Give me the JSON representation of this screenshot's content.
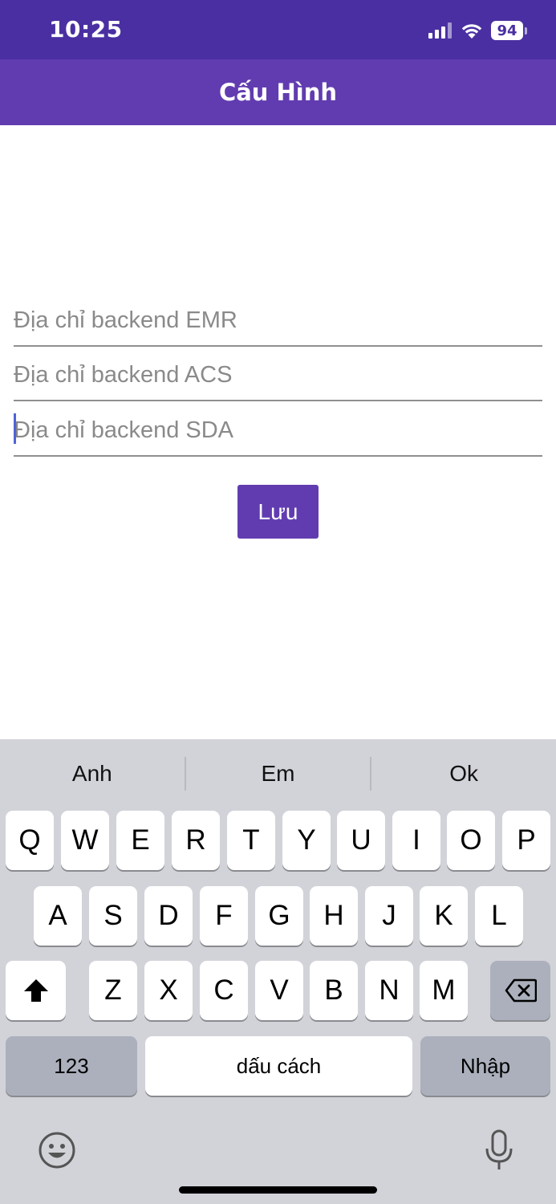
{
  "status_bar": {
    "time": "10:25",
    "battery": "94",
    "icons": [
      "signal-icon",
      "wifi-icon",
      "battery-icon"
    ]
  },
  "app_bar": {
    "title": "Cấu Hình"
  },
  "form": {
    "fields": [
      {
        "placeholder": "Địa chỉ backend EMR",
        "value": ""
      },
      {
        "placeholder": "Địa chỉ backend ACS",
        "value": ""
      },
      {
        "placeholder": "Địa chỉ backend SDA",
        "value": ""
      }
    ],
    "save_label": "Lưu"
  },
  "keyboard": {
    "suggestions": [
      "Anh",
      "Em",
      "Ok"
    ],
    "row1": [
      "Q",
      "W",
      "E",
      "R",
      "T",
      "Y",
      "U",
      "I",
      "O",
      "P"
    ],
    "row2": [
      "A",
      "S",
      "D",
      "F",
      "G",
      "H",
      "J",
      "K",
      "L"
    ],
    "row3": [
      "Z",
      "X",
      "C",
      "V",
      "B",
      "N",
      "M"
    ],
    "numbers_label": "123",
    "space_label": "dấu cách",
    "return_label": "Nhập"
  },
  "colors": {
    "status_bar": "#4a2fa2",
    "app_bar": "#613cb0",
    "button": "#613cb0",
    "caret": "#4f64d8",
    "keyboard_bg": "#d2d3d9"
  }
}
